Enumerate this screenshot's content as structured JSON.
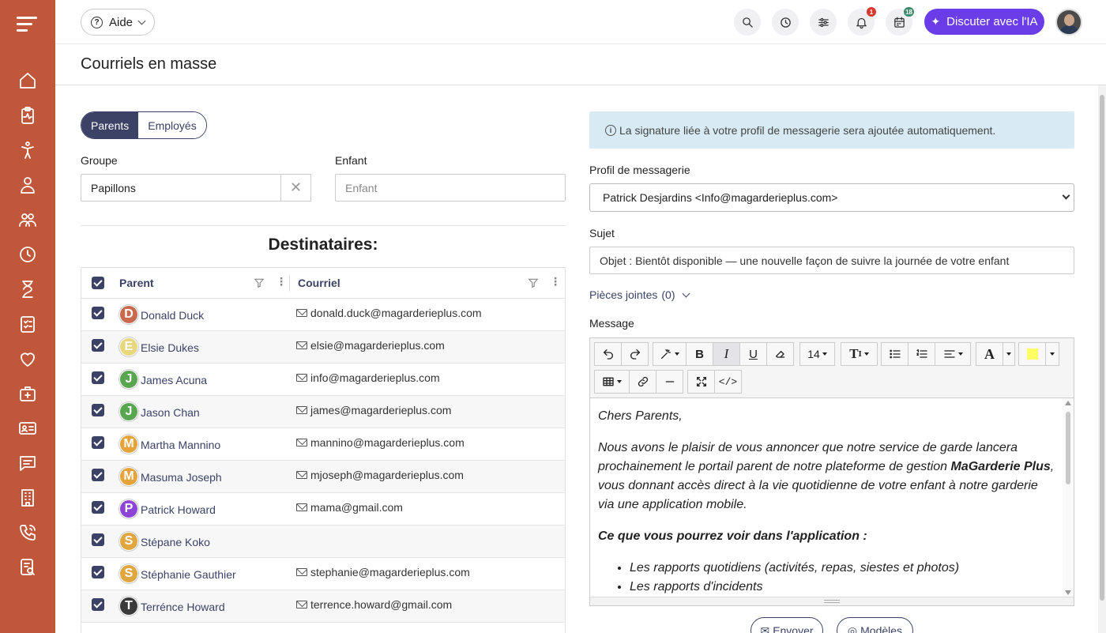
{
  "topbar": {
    "help_label": "Aide",
    "notif_badge": "1",
    "calendar_badge": "18",
    "ai_label": "Discuter avec l'IA"
  },
  "page": {
    "title": "Courriels en masse"
  },
  "audience_toggle": {
    "options": [
      "Parents",
      "Employés"
    ],
    "selected": "Parents"
  },
  "filters": {
    "group_label": "Groupe",
    "group_value": "Papillons",
    "child_label": "Enfant",
    "child_placeholder": "Enfant"
  },
  "recipients": {
    "title": "Destinataires:",
    "columns": [
      "Parent",
      "Courriel"
    ],
    "rows": [
      {
        "initial": "D",
        "color": "#c96a4f",
        "name": "Donald Duck",
        "email": "donald.duck@magarderieplus.com",
        "checked": true
      },
      {
        "initial": "E",
        "color": "#e8d77c",
        "name": "Elsie Dukes",
        "email": "elsie@magarderieplus.com",
        "checked": true
      },
      {
        "initial": "J",
        "color": "#58a64f",
        "name": "James Acuna",
        "email": "info@magarderieplus.com",
        "checked": true
      },
      {
        "initial": "J",
        "color": "#58a64f",
        "name": "Jason Chan",
        "email": "james@magarderieplus.com",
        "checked": true
      },
      {
        "initial": "M",
        "color": "#e6a33a",
        "name": "Martha Mannino",
        "email": "mannino@magarderieplus.com",
        "checked": true
      },
      {
        "initial": "M",
        "color": "#e6a33a",
        "name": "Masuma Joseph",
        "email": "mjoseph@magarderieplus.com",
        "checked": true
      },
      {
        "initial": "P",
        "color": "#8e44d6",
        "name": "Patrick Howard",
        "email": "mama@gmail.com",
        "checked": true
      },
      {
        "initial": "S",
        "color": "#e0a63f",
        "name": "Stépane Koko",
        "email": "",
        "checked": true
      },
      {
        "initial": "S",
        "color": "#e0a63f",
        "name": "Stéphanie Gauthier",
        "email": "stephanie@magarderieplus.com",
        "checked": true
      },
      {
        "initial": "T",
        "color": "#3a3a3a",
        "name": "Terrénce Howard",
        "email": "terrence.howard@gmail.com",
        "checked": true
      }
    ]
  },
  "compose": {
    "info_text": "La signature liée à votre profil de messagerie sera ajoutée automatiquement.",
    "profile_label": "Profil de messagerie",
    "profile_value": "Patrick Desjardins <Info@magarderieplus.com>",
    "subject_label": "Sujet",
    "subject_value": "Objet : Bientôt disponible — une nouvelle façon de suivre la journée de votre enfant",
    "attachments_label": "Pièces jointes",
    "attachments_count": "(0)",
    "message_label": "Message",
    "font_size": "14",
    "body": {
      "greeting": "Chers Parents,",
      "para1_before": "Nous avons le plaisir de vous annoncer que notre service de garde lancera prochainement le portail parent de notre plateforme de gestion ",
      "para1_brand": "MaGarderie Plus",
      "para1_after": ", vous donnant accès direct à la vie quotidienne de votre enfant à notre garderie via une application mobile.",
      "heading": "Ce que vous pourrez voir dans l'application :",
      "bullets": [
        "Les rapports quotidiens (activités, repas, siestes et photos)",
        "Les rapports d'incidents"
      ]
    },
    "send_label": "Envoyer",
    "templates_label": "Modèles"
  },
  "colors": {
    "sidebar": "#c0563a",
    "primary": "#3b4266",
    "ai": "#6a3de8",
    "info_bg": "#d8eaf3"
  }
}
